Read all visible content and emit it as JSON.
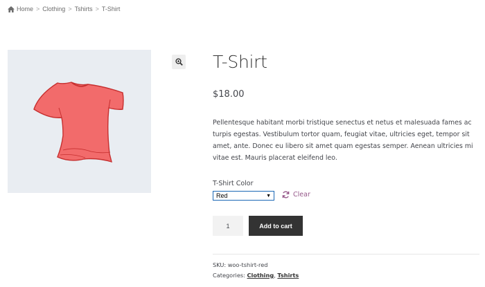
{
  "breadcrumb": {
    "home": "Home",
    "items": [
      "Clothing",
      "Tshirts"
    ],
    "current": "T-Shirt",
    "separator": ">"
  },
  "product": {
    "title": "T-Shirt",
    "price": "$18.00",
    "description": "Pellentesque habitant morbi tristique senectus et netus et malesuada fames ac turpis egestas. Vestibulum tortor quam, feugiat vitae, ultricies eget, tempor sit amet, ante. Donec eu libero sit amet quam egestas semper. Aenean ultricies mi vitae est. Mauris placerat eleifend leo.",
    "image_color": "#f26b6b"
  },
  "variation": {
    "label": "T-Shirt Color",
    "selected": "Red",
    "clear_label": "Clear"
  },
  "cart": {
    "quantity": "1",
    "add_label": "Add to cart"
  },
  "meta": {
    "sku_label": "SKU:",
    "sku": "woo-tshirt-red",
    "categories_label": "Categories:",
    "categories": [
      "Clothing",
      "Tshirts"
    ],
    "categories_separator": ","
  },
  "colors": {
    "accent": "#96588a",
    "button": "#333333",
    "gallery_bg": "#e9edf2"
  },
  "icons": {
    "home": "home-icon",
    "zoom": "magnifier-zoom-icon",
    "clear": "refresh-icon"
  }
}
